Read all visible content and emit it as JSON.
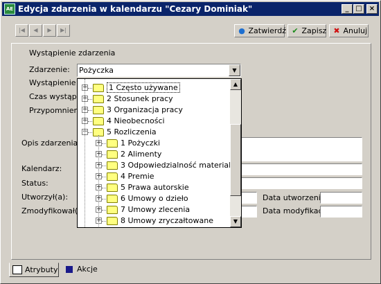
{
  "window": {
    "title": "Edycja zdarzenia w kalendarzu \"Cezary Dominiak\"",
    "app_icon": "AE",
    "controls": {
      "minimize": "_",
      "maximize": "□",
      "close": "×"
    }
  },
  "toolbar": {
    "nav": {
      "first": "|◀",
      "prev": "◀",
      "next": "▶",
      "last": "▶|"
    },
    "confirm_label": "Zatwierdź",
    "save_label": "Zapisz",
    "cancel_label": "Anuluj",
    "confirm_icon": "●",
    "save_icon": "✔",
    "cancel_icon": "✖"
  },
  "form": {
    "section_title": "Wystąpienie zdarzenia",
    "event_label": "Zdarzenie:",
    "event_value": "Pożyczka",
    "row3_label": "Wystąpienie w",
    "row4_label": "Czas wystąpi",
    "row5_label": "Przypomnienie",
    "description_label": "Opis zdarzenia:",
    "calendar_label": "Kalendarz:",
    "status_label": "Status:",
    "created_by_label": "Utworzył(a):",
    "modified_by_label": "Zmodyfikował(a",
    "created_date_label": "Data utworzenia:",
    "modified_date_label": "Data modyfikacji:"
  },
  "dropdown": {
    "items": [
      {
        "label": "1 Często używane",
        "level": 0,
        "expander": "+"
      },
      {
        "label": "2 Stosunek pracy",
        "level": 0,
        "expander": "+"
      },
      {
        "label": "3 Organizacja pracy",
        "level": 0,
        "expander": "+"
      },
      {
        "label": "4 Nieobecności",
        "level": 0,
        "expander": "+"
      },
      {
        "label": "5 Rozliczenia",
        "level": 0,
        "expander": "−"
      },
      {
        "label": "1 Pożyczki",
        "level": 1,
        "expander": "+"
      },
      {
        "label": "2 Alimenty",
        "level": 1,
        "expander": "+"
      },
      {
        "label": "3 Odpowiedzialność materialna",
        "level": 1,
        "expander": "+"
      },
      {
        "label": "4 Premie",
        "level": 1,
        "expander": "+"
      },
      {
        "label": "5 Prawa autorskie",
        "level": 1,
        "expander": "+"
      },
      {
        "label": "6 Umowy o dzieło",
        "level": 1,
        "expander": "+"
      },
      {
        "label": "7 Umowy zlecenia",
        "level": 1,
        "expander": "+"
      },
      {
        "label": "8 Umowy zryczałtowane",
        "level": 1,
        "expander": "+"
      }
    ],
    "scroll_up": "▲",
    "scroll_down": "▼"
  },
  "tabs": {
    "attributes_label": "Atrybuty",
    "actions_label": "Akcje"
  }
}
